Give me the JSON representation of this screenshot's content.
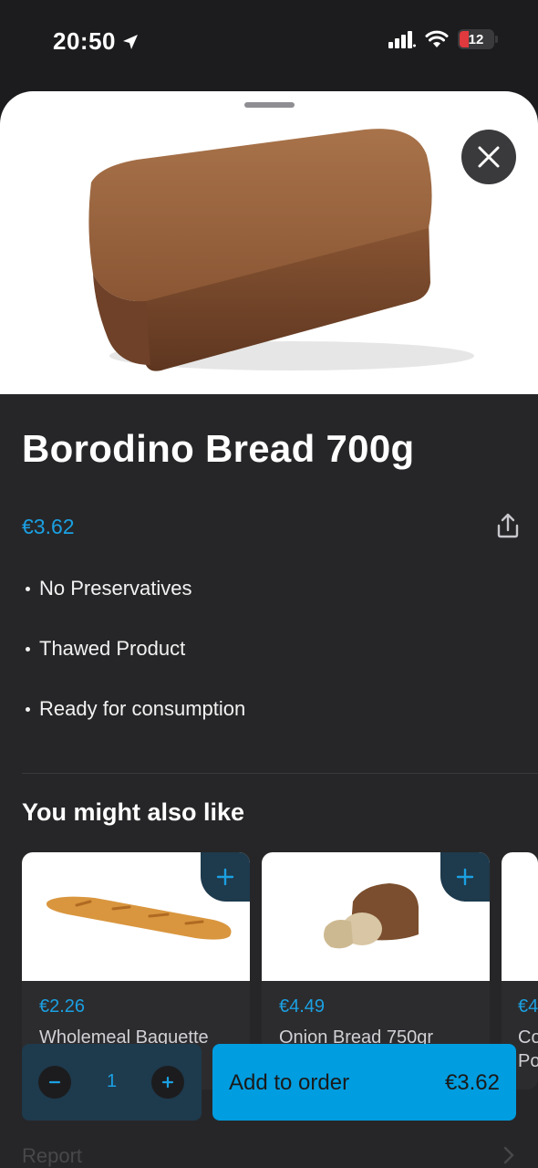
{
  "status_bar": {
    "time": "20:50",
    "battery": "12",
    "icons": [
      "location-arrow-icon",
      "signal-icon",
      "wifi-icon",
      "battery-icon"
    ]
  },
  "product": {
    "title": "Borodino Bread 700g",
    "price": "€3.62",
    "features": [
      "No Preservatives",
      "Thawed Product",
      "Ready for consumption"
    ]
  },
  "recommendations": {
    "title": "You might also like",
    "items": [
      {
        "price": "€2.26",
        "name": "Wholemeal Baguette"
      },
      {
        "price": "€4.49",
        "name": "Onion Bread 750gr"
      },
      {
        "price": "€4",
        "name": "Co"
      }
    ],
    "partial_name_line2": "Po"
  },
  "order_bar": {
    "quantity": "1",
    "add_label": "Add to order",
    "add_price": "€3.62"
  },
  "footer": {
    "report_label": "Report"
  },
  "colors": {
    "accent": "#1ba0e2",
    "button": "#009de0",
    "sheet_bg": "#262628",
    "card_bg": "#2c2c2e"
  }
}
